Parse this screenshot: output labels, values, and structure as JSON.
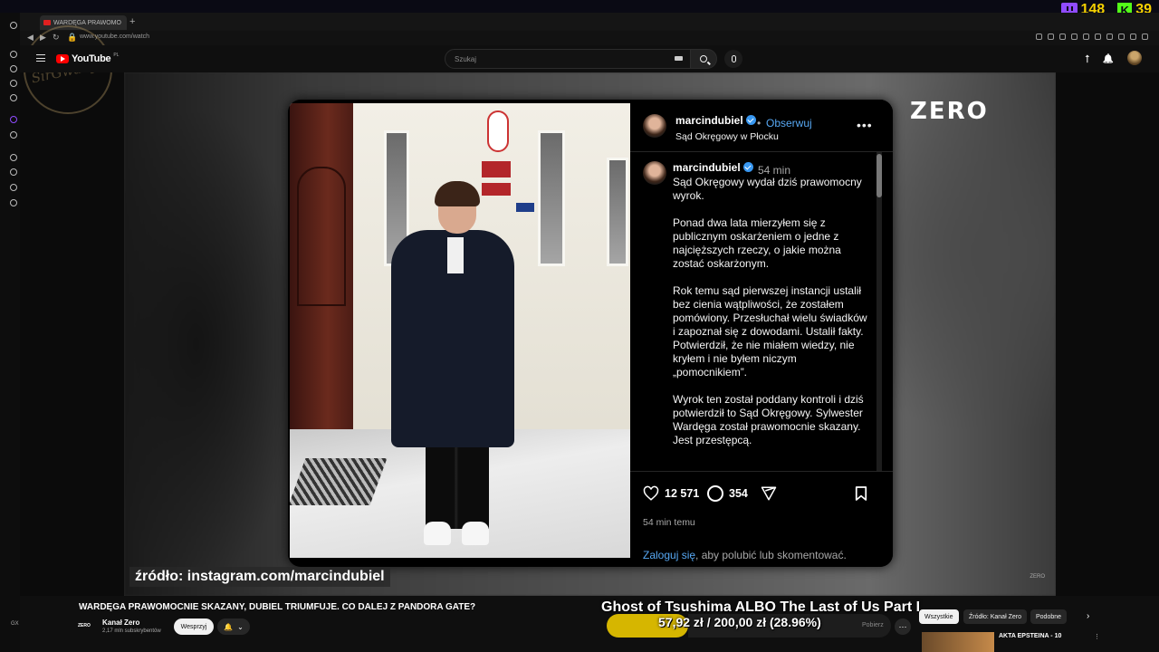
{
  "stream_overlay": {
    "twitch_count": "148",
    "kick_count": "39",
    "kick_letter": "K"
  },
  "browser": {
    "tab_title": "WARDĘGA PRAWOMO",
    "url": "www.youtube.com/watch",
    "watermark": "SirGwany"
  },
  "youtube": {
    "logo_text": "YouTube",
    "logo_country": "PL",
    "search_placeholder": "Szukaj"
  },
  "video": {
    "channel_watermark": "ZERO",
    "corner_mark": "ZERO",
    "source_caption": "źródło: instagram.com/marcindubiel",
    "instagram_post": {
      "username": "marcindubiel",
      "follow_label": "Obserwuj",
      "location": "Sąd Okręgowy w Płocku",
      "comment_time": "54 min",
      "caption": "Sąd Okręgowy wydał dziś prawomocny wyrok.\n\nPonad dwa lata mierzyłem się z publicznym oskarżeniem o jedne z najcięższych rzeczy, o jakie można zostać oskarżonym.\n\nRok temu sąd pierwszej instancji ustalił bez cienia wątpliwości, że zostałem pomówiony. Przesłuchał wielu świadków i zapoznał się z dowodami. Ustalił fakty. Potwierdził, że nie miałem wiedzy, nie kryłem i nie byłem niczym „pomocnikiem”.\n\nWyrok ten został poddany kontroli i dziś potwierdził to Sąd Okręgowy. Sylwester Wardęga został prawomocnie skazany. Jest przestępcą.",
      "likes": "12 571",
      "comments": "354",
      "posted_ago": "54 min temu",
      "login_link": "Zaloguj się",
      "login_rest": ", aby polubić lub skomentować."
    }
  },
  "below_video": {
    "title": "WARDĘGA PRAWOMOCNIE SKAZANY, DUBIEL TRIUMFUJE. CO DALEJ Z PANDORA GATE?",
    "channel_logo": "ZERO",
    "channel_name": "Kanał Zero",
    "subscribers": "2,17 mln subskrybentów",
    "support_label": "Wesprzyj",
    "download_label": "Pobierz",
    "overlay_game": "Ghost of Tsushima ALBO The Last of Us Part I",
    "overlay_price": "57,92 zł  /  200,00 zł  (28.96%)",
    "chips": [
      "Wszystkie",
      "Źródło: Kanał Zero",
      "Podobne"
    ],
    "recommended_title": "AKTA EPSTEINA - 10"
  },
  "misc": {
    "gx_label": "GX"
  },
  "colors": {
    "youtube_red": "#ff0000",
    "instagram_blue": "#57a8f3",
    "twitch_purple": "#8f4bff",
    "kick_green": "#53fc18",
    "overlay_yellow": "#f5d000"
  }
}
